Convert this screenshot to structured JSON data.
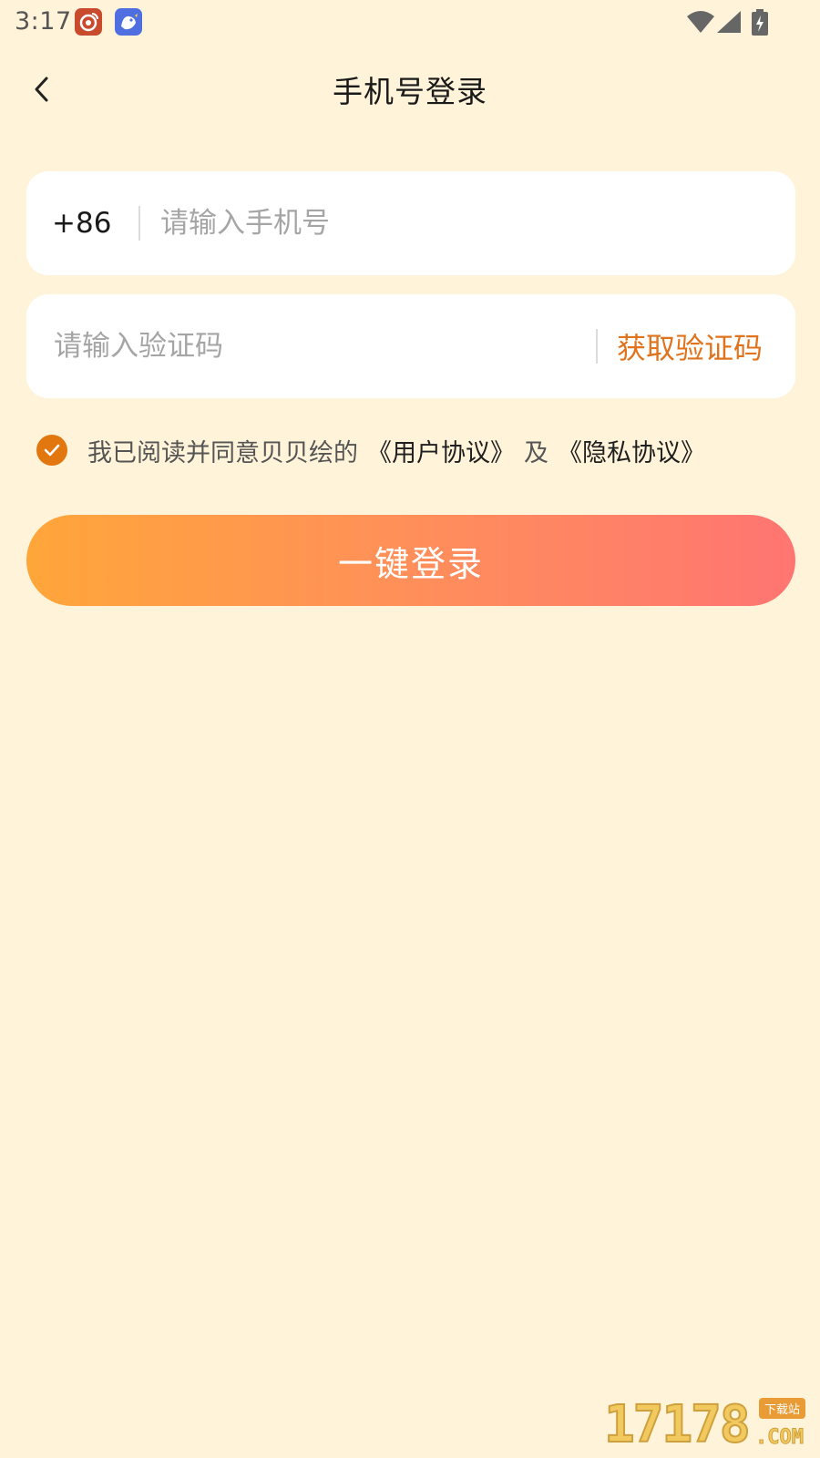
{
  "status_bar": {
    "time": "3:17",
    "icons": [
      "weibo-app-icon",
      "bird-app-icon",
      "wifi-icon",
      "signal-icon",
      "battery-charging-icon"
    ]
  },
  "nav": {
    "back_icon": "chevron-left-icon",
    "title": "手机号登录"
  },
  "phone_field": {
    "country_code": "+86",
    "placeholder": "请输入手机号",
    "value": ""
  },
  "code_field": {
    "placeholder": "请输入验证码",
    "value": "",
    "get_code_label": "获取验证码"
  },
  "agreement": {
    "checked": true,
    "text": "我已阅读并同意贝贝绘的",
    "user_agreement": "《用户协议》",
    "and": "及",
    "privacy_agreement": "《隐私协议》"
  },
  "login_button": {
    "label": "一键登录"
  },
  "watermark": {
    "digits": "17178",
    "tag": "下载站",
    "suffix": ".COM"
  },
  "colors": {
    "background": "#fff3d9",
    "accent": "#e0731c",
    "button_gradient_start": "#ffa63a",
    "button_gradient_end": "#ff7572"
  }
}
